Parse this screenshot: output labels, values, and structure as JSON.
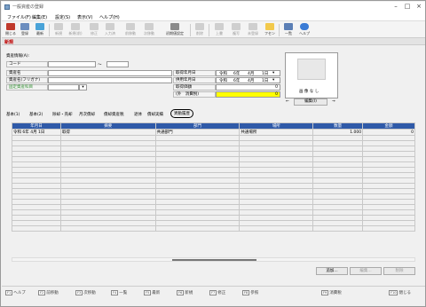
{
  "window": {
    "title": "一般資産の登録"
  },
  "menu": [
    "ファイル(F)",
    "編集(E)",
    "設定(S)",
    "表示(V)",
    "ヘルプ(H)"
  ],
  "toolbar": [
    {
      "label": "閉じる",
      "icon": "close-icon",
      "enabled": true
    },
    {
      "label": "登録",
      "icon": "save-icon",
      "enabled": true
    },
    {
      "label": "最新",
      "icon": "refresh-icon",
      "enabled": true
    },
    {
      "label": "新規",
      "icon": "new-icon",
      "enabled": false
    },
    {
      "label": "新規(前)",
      "icon": "new-copy-icon",
      "enabled": false
    },
    {
      "label": "修正",
      "icon": "edit-icon",
      "enabled": false
    },
    {
      "label": "入力済",
      "icon": "input-icon",
      "enabled": false
    },
    {
      "label": "前移動",
      "icon": "prev-icon",
      "enabled": false
    },
    {
      "label": "次移動",
      "icon": "next-icon",
      "enabled": false
    },
    {
      "label": "初期値設定",
      "icon": "defaults-icon",
      "enabled": true
    },
    {
      "label": "削除",
      "icon": "delete-icon",
      "enabled": false
    },
    {
      "label": "上書",
      "icon": "overwrite-icon",
      "enabled": false
    },
    {
      "label": "複写",
      "icon": "copy-icon",
      "enabled": false
    },
    {
      "label": "未登録",
      "icon": "unregistered-icon",
      "enabled": false
    },
    {
      "label": "フセン",
      "icon": "sticky-note-icon",
      "enabled": true
    },
    {
      "label": "一覧",
      "icon": "list-icon",
      "enabled": true
    },
    {
      "label": "ヘルプ",
      "icon": "help-icon",
      "enabled": true
    }
  ],
  "mode": "新規",
  "form": {
    "section_title": "資産情報(A):",
    "code_label": "コード",
    "code_sep": "～",
    "name_label": "資産名",
    "kana_label": "資産名(フリガナ)",
    "category_label": "固定資産科目",
    "acquire_date_label": "取得年月日",
    "acquire_date": {
      "era": "令和",
      "year": "6年",
      "month": "4月",
      "day": "1日"
    },
    "use_date_label": "供用年月日",
    "use_date": {
      "era": "令和",
      "year": "6年",
      "month": "4月",
      "day": "1日"
    },
    "cost_label": "取得価額",
    "cost_value": "0",
    "tax_label": "(外　消費税)",
    "tax_value": "0"
  },
  "image_panel": {
    "no_image_label": "画 像 な し",
    "edit_button": "編集(I)"
  },
  "tabs": [
    "基本(1)",
    "基本(2)",
    "除却・売却",
    "月次償却",
    "償却資産税",
    "退体",
    "償却実績",
    "異動履歴"
  ],
  "active_tab": "異動履歴",
  "history_table": {
    "columns": [
      "年月日",
      "摘要",
      "部門",
      "場所",
      "数量",
      "金額"
    ],
    "rows": [
      {
        "date": "令和 6年 4月 1日",
        "summary": "取得",
        "dept": "共通部門",
        "place": "共通場所",
        "qty": "1.000",
        "amount": "0"
      }
    ],
    "empty_rows": 18
  },
  "table_buttons": {
    "add": "追加...",
    "edit": "編集...",
    "delete": "削除"
  },
  "fkeys": [
    {
      "key": "F1",
      "label": "ヘルプ"
    },
    {
      "key": "F2",
      "label": "前移動"
    },
    {
      "key": "F3",
      "label": "次移動"
    },
    {
      "key": "F4",
      "label": "一覧"
    },
    {
      "key": "F5",
      "label": "最新"
    },
    {
      "key": "F6",
      "label": "新規"
    },
    {
      "key": "F7",
      "label": "修正"
    },
    {
      "key": "F8",
      "label": "参照"
    },
    {
      "key": "F9",
      "label": "消費税"
    },
    {
      "key": "F10",
      "label": "閉じる"
    }
  ],
  "colors": {
    "mode_red": "#c00000",
    "header_blue": "#2f5aa8",
    "highlight_yellow": "#ffff00",
    "category_green": "#2b8a2b"
  }
}
